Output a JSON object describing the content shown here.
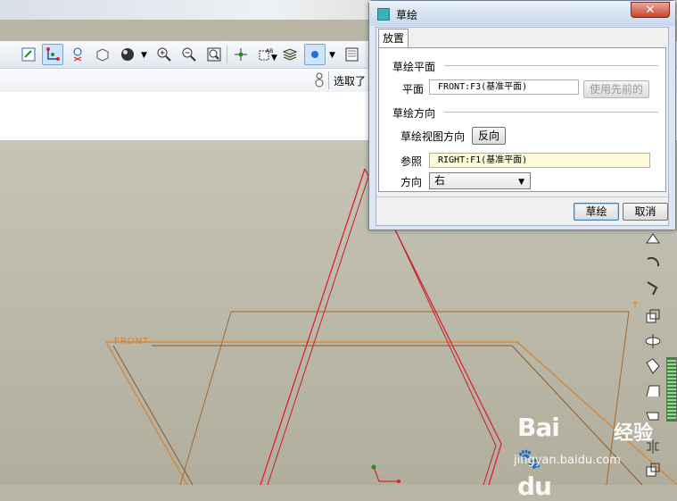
{
  "toolbar": {
    "icons": [
      "sketch-settings-icon",
      "datum-axis-icon",
      "datum-point-icon",
      "view-orient-icon",
      "shading-icon",
      "zoom-in-icon",
      "zoom-out-icon",
      "refit-icon",
      "spin-center-icon",
      "annotation-icon",
      "layers-icon",
      "display-style-icon",
      "model-tree-icon"
    ]
  },
  "status": {
    "selected_text": "选取了"
  },
  "graphics": {
    "front_label": "FRONT",
    "top_label": "T"
  },
  "dialog": {
    "title": "草绘",
    "tab_label": "放置",
    "sketch_plane": {
      "group_title": "草绘平面",
      "plane_label": "平面",
      "plane_value": "FRONT:F3(基准平面)",
      "use_previous_label": "使用先前的"
    },
    "orientation": {
      "group_title": "草绘方向",
      "view_dir_label": "草绘视图方向",
      "flip_label": "反向",
      "reference_label": "参照",
      "reference_value": "RIGHT:F1(基准平面)",
      "direction_label": "方向",
      "direction_value": "右"
    },
    "sketch_button": "草绘",
    "cancel_button": "取消",
    "close_glyph": "✕"
  },
  "watermark": {
    "logo": "Bai",
    "logo2": "du",
    "sub": "经验",
    "url": "jingyan.baidu.com"
  },
  "colors": {
    "datum_plane": "#d9822b",
    "sketch_line": "#e0202a",
    "graphics_bg": "#bdbaab",
    "dialog_bg": "#dbe6f4"
  }
}
